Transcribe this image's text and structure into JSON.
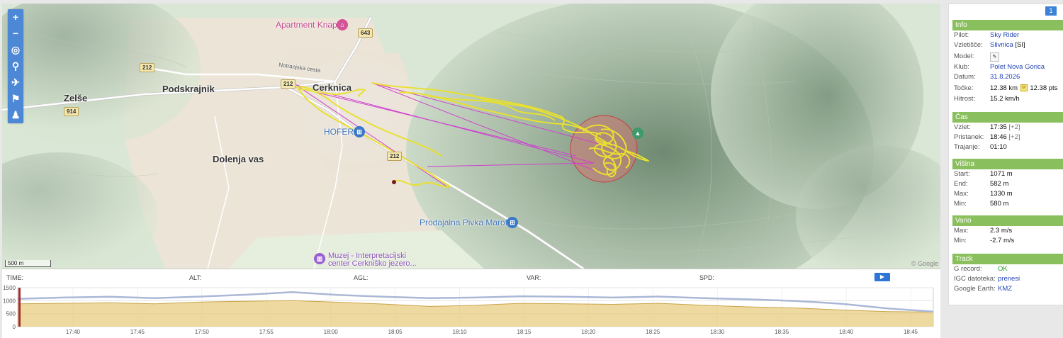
{
  "map": {
    "places": {
      "apartment": "Apartment Knap",
      "podskrajnik": "Podskrajnik",
      "zelse": "Zelše",
      "cerknica": "Cerknica",
      "dolenja_vas": "Dolenja vas",
      "hofer": "HOFER",
      "prodajalna": "Prodajalna Pivka Marof",
      "muzej_line1": "Muzej - Interpretacijski",
      "muzej_line2": "center Cerkniško jezero...",
      "street": "Notranjska cesta"
    },
    "road_shields": {
      "r643": "643",
      "r212a": "212",
      "r212b": "212",
      "r212c": "212",
      "r914": "914"
    },
    "scale": "500 m",
    "attribution": "© Google",
    "toolbar": [
      {
        "name": "zoom-in-button",
        "glyph": "+"
      },
      {
        "name": "zoom-out-button",
        "glyph": "−"
      },
      {
        "name": "locate-button",
        "glyph": "◎"
      },
      {
        "name": "marker-button",
        "glyph": "⚲"
      },
      {
        "name": "flight-button",
        "glyph": "✈"
      },
      {
        "name": "flag-button",
        "glyph": "⚑"
      },
      {
        "name": "group-button",
        "glyph": "♟"
      }
    ]
  },
  "chart_panel": {
    "labels": {
      "time": "TIME:",
      "alt": "ALT:",
      "agl": "AGL:",
      "var": "VAR:",
      "spd": "SPD:"
    },
    "play": "▶"
  },
  "chart_data": {
    "type": "area",
    "ylim": [
      0,
      1500
    ],
    "yticks": [
      "1500",
      "1000",
      "500",
      "0"
    ],
    "xticks": [
      "17:40",
      "17:45",
      "17:50",
      "17:55",
      "18:00",
      "18:05",
      "18:10",
      "18:15",
      "18:20",
      "18:25",
      "18:30",
      "18:35",
      "18:40",
      "18:45"
    ],
    "series": [
      {
        "values": [
          1071,
          1120,
          1150,
          1100,
          1160,
          1230,
          1330,
          1220,
          1150,
          1100,
          1120,
          1170,
          1150,
          1120,
          1160,
          1100,
          1050,
          990,
          880,
          700,
          582
        ],
        "color": "#aab8d6"
      },
      {
        "values": [
          880,
          900,
          920,
          880,
          950,
          980,
          1000,
          940,
          870,
          780,
          820,
          900,
          880,
          860,
          900,
          820,
          760,
          720,
          640,
          580,
          560
        ],
        "color": "#e0c070"
      }
    ],
    "colors": {
      "alt_line": "#aab8d6",
      "agl_area": "#e8cc80",
      "agl_line": "#c9a44a",
      "cursor": "#a03030"
    }
  },
  "side": {
    "flight_no": "1",
    "info": {
      "header": "Info",
      "pilot_k": "Pilot:",
      "pilot_v": "Sky Rider",
      "site_k": "Vzletišče:",
      "site_v": "Slivnica",
      "site_cc": "[SI]",
      "model_k": "Model:",
      "club_k": "Klub:",
      "club_v": "Polet Nova Gorica",
      "date_k": "Datum:",
      "date_v": "31.8.2026",
      "points_k": "Točke:",
      "points_km": "12.38 km",
      "points_badge": "M",
      "points_pts": "12.38 pts",
      "speed_k": "Hitrost:",
      "speed_v": "15.2 km/h"
    },
    "time": {
      "header": "Čas",
      "takeoff_k": "Vzlet:",
      "takeoff_v": "17:35",
      "takeoff_tz": "[+2]",
      "landing_k": "Pristanek:",
      "landing_v": "18:46",
      "landing_tz": "[+2]",
      "duration_k": "Trajanje:",
      "duration_v": "01:10"
    },
    "alt": {
      "header": "Višina",
      "start_k": "Start:",
      "start_v": "1071 m",
      "end_k": "End:",
      "end_v": "582 m",
      "max_k": "Max:",
      "max_v": "1330 m",
      "min_k": "Min:",
      "min_v": "580 m"
    },
    "vario": {
      "header": "Vario",
      "max_k": "Max:",
      "max_v": "2.3 m/s",
      "min_k": "Min:",
      "min_v": "-2.7 m/s"
    },
    "track": {
      "header": "Track",
      "grec_k": "G record:",
      "grec_v": "OK",
      "igc_k": "IGC datoteka:",
      "igc_v": "prenesi",
      "ge_k": "Google Earth:",
      "ge_v": "KMZ"
    }
  }
}
